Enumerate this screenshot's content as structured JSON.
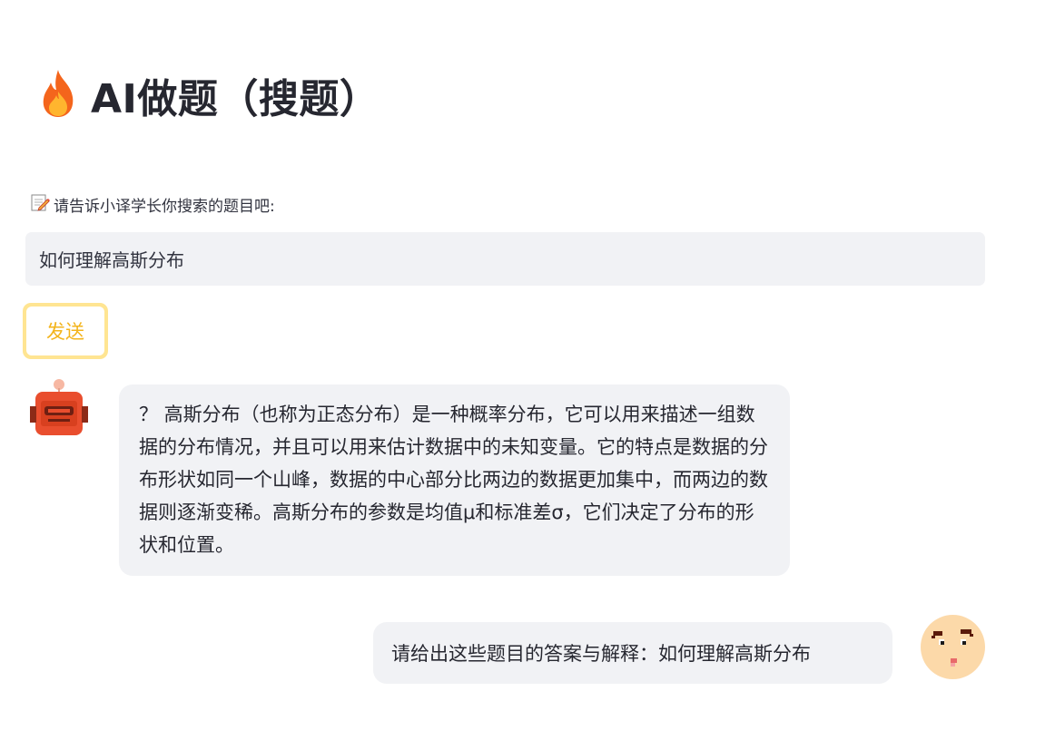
{
  "header": {
    "title": "AI做题（搜题）",
    "icon": "fire-icon"
  },
  "form": {
    "label": "请告诉小译学长你搜索的题目吧:",
    "label_icon": "memo-icon",
    "input_value": "如何理解高斯分布",
    "send_label": "发送"
  },
  "chat": {
    "bot_avatar_icon": "robot-icon",
    "bot_message": "？ 高斯分布（也称为正态分布）是一种概率分布，它可以用来描述一组数据的分布情况，并且可以用来估计数据中的未知变量。它的特点是数据的分布形状如同一个山峰，数据的中心部分比两边的数据更加集中，而两边的数据则逐渐变稀。高斯分布的参数是均值μ和标准差σ，它们决定了分布的形状和位置。",
    "user_message": "请给出这些题目的答案与解释：如何理解高斯分布",
    "user_avatar_icon": "face-avatar-icon"
  },
  "colors": {
    "accent_button_border": "#ffe592",
    "accent_button_text": "#f3b41c",
    "bubble_background": "#f1f2f5"
  }
}
